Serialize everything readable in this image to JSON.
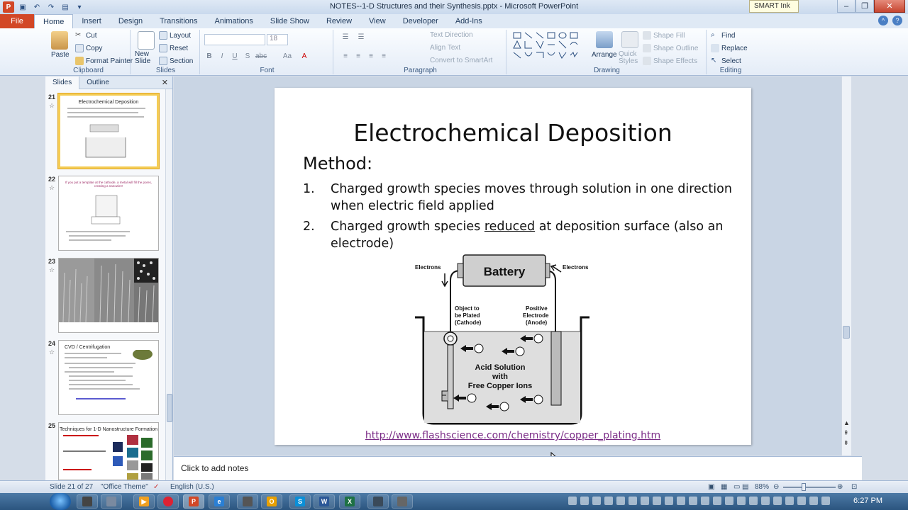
{
  "window": {
    "title": "NOTES--1-D Structures and their Synthesis.pptx - Microsoft PowerPoint",
    "smart_ink": "SMART Ink"
  },
  "tabs": [
    "File",
    "Home",
    "Insert",
    "Design",
    "Transitions",
    "Animations",
    "Slide Show",
    "Review",
    "View",
    "Developer",
    "Add-Ins"
  ],
  "ribbon": {
    "clipboard": {
      "paste": "Paste",
      "cut": "Cut",
      "copy": "Copy",
      "format_painter": "Format Painter",
      "label": "Clipboard"
    },
    "slides": {
      "new_slide": "New Slide",
      "layout": "Layout",
      "reset": "Reset",
      "section": "Section",
      "label": "Slides"
    },
    "font": {
      "size": "18",
      "label": "Font"
    },
    "paragraph": {
      "text_direction": "Text Direction",
      "align_text": "Align Text",
      "convert_smartart": "Convert to SmartArt",
      "label": "Paragraph"
    },
    "drawing": {
      "arrange": "Arrange",
      "quick_styles": "Quick Styles",
      "shape_fill": "Shape Fill",
      "shape_outline": "Shape Outline",
      "shape_effects": "Shape Effects",
      "label": "Drawing"
    },
    "editing": {
      "find": "Find",
      "replace": "Replace",
      "select": "Select",
      "label": "Editing"
    }
  },
  "panel": {
    "tab_slides": "Slides",
    "tab_outline": "Outline",
    "thumbnails": [
      {
        "num": "21",
        "title": "Electrochemical Deposition"
      },
      {
        "num": "22",
        "title": "If you put a template at the cathode, a metal will fill the pores, creating a nanowire!"
      },
      {
        "num": "23",
        "title": ""
      },
      {
        "num": "24",
        "title": "CVD / Centrifugation"
      },
      {
        "num": "25",
        "title": "Techniques for 1-D Nanostructure Formation"
      }
    ]
  },
  "slide": {
    "title": "Electrochemical Deposition",
    "method": "Method:",
    "items": [
      {
        "num": "1.",
        "text": "Charged growth species moves through solution in one direction when electric field applied"
      },
      {
        "num": "2.",
        "pre": "Charged growth species ",
        "underlined": "reduced",
        "post": " at deposition surface (also an electrode)"
      }
    ],
    "diagram": {
      "battery": "Battery",
      "electrons_left": "Electrons",
      "electrons_right": "Electrons",
      "cathode": [
        "Object to",
        "be Plated",
        "(Cathode)"
      ],
      "anode": [
        "Positive",
        "Electrode",
        "(Anode)"
      ],
      "solution": [
        "Acid Solution",
        "with",
        "Free Copper Ions"
      ]
    },
    "link": "http://www.flashscience.com/chemistry/copper_plating.htm"
  },
  "notes": {
    "placeholder": "Click to add notes"
  },
  "status": {
    "slide_of": "Slide 21 of 27",
    "theme": "\"Office Theme\"",
    "language": "English (U.S.)",
    "zoom": "88%"
  },
  "taskbar": {
    "clock": "6:27 PM"
  },
  "colors": {
    "file_tab": "#d24726",
    "selected_thumb": "#f4cc55",
    "link": "#7a2b86"
  }
}
